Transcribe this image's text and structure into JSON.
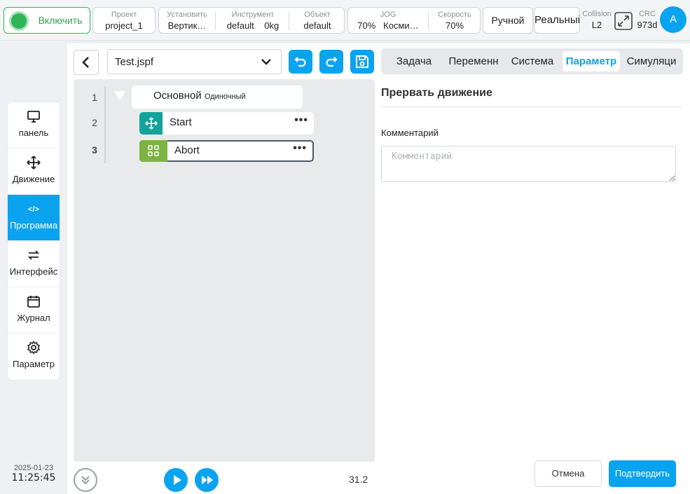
{
  "topbar": {
    "power_label": "Включить",
    "project": {
      "label": "Проект",
      "value": "project_1"
    },
    "install": {
      "label": "Установить",
      "value": "Вертик…"
    },
    "tool": {
      "label": "Инструмент",
      "value": "default",
      "weight": "0kg"
    },
    "object": {
      "label": "Объект",
      "value": "default"
    },
    "jog": {
      "label": "JOG",
      "value": "70%",
      "frame": "Косми…"
    },
    "speed": {
      "label": "Скорость",
      "value": "70%"
    },
    "mode": "Ручной",
    "real": "Реальный",
    "collision": {
      "label": "Collision",
      "value": "L2"
    },
    "crc": {
      "label": "CRC",
      "value": "973d"
    },
    "avatar": "A"
  },
  "sidebar": {
    "items": [
      {
        "label": "панель",
        "icon": "monitor-icon"
      },
      {
        "label": "Движение",
        "icon": "move-icon"
      },
      {
        "label": "Программа",
        "icon": "code-icon"
      },
      {
        "label": "Интерфейс",
        "icon": "swap-icon"
      },
      {
        "label": "Журнал",
        "icon": "calendar-icon"
      },
      {
        "label": "Параметр",
        "icon": "gear-icon"
      }
    ],
    "active_index": 2
  },
  "clock": {
    "date": "2025-01-23",
    "time": "11:25:45"
  },
  "editor": {
    "file_name": "Test.jspf",
    "lines": [
      {
        "no": "1",
        "label": "Основной",
        "sub": "Одиночный"
      },
      {
        "no": "2",
        "label": "Start"
      },
      {
        "no": "3",
        "label": "Abort"
      }
    ],
    "version": "31.2"
  },
  "tabs": [
    "Задача",
    "Переменн",
    "Система",
    "Параметр",
    "Симуляци"
  ],
  "active_tab": 3,
  "panel": {
    "title": "Прервать движение",
    "comment_label": "Комментарий",
    "comment_placeholder": "Комментарий",
    "cancel": "Отмена",
    "confirm": "Подтвердить"
  },
  "colors": {
    "accent": "#0aa3ef",
    "power": "#2fb558",
    "move_node": "#14a39a",
    "abort_node": "#7cb342"
  }
}
